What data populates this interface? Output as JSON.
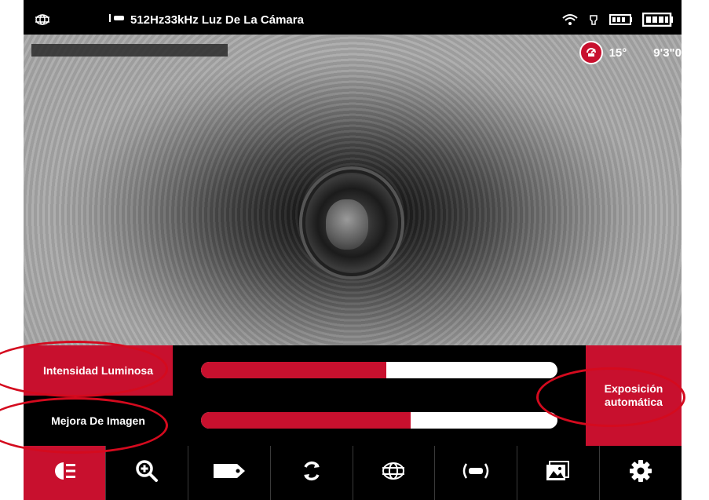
{
  "status_bar": {
    "frequency_text": "512Hz33kHz Luz De La Cámara",
    "icons": [
      "grid-icon",
      "sonde-icon",
      "wifi-icon",
      "flashlight-icon",
      "battery-small-icon",
      "battery-large-icon"
    ]
  },
  "camera": {
    "tilt": "15°",
    "distance": "9'3\"0"
  },
  "controls": {
    "intensidad_label": "Intensidad Luminosa",
    "mejora_label": "Mejora De Imagen",
    "exposicion_label": "Exposición automática",
    "intensidad_level": 0.53,
    "mejora_level": 0.6
  },
  "toolbar": {
    "buttons": [
      {
        "name": "light-button",
        "icon": "light-icon",
        "active": true
      },
      {
        "name": "zoom-button",
        "icon": "zoom-in-icon",
        "active": false
      },
      {
        "name": "tag-button",
        "icon": "tag-icon",
        "active": false
      },
      {
        "name": "rotate-button",
        "icon": "rotate-icon",
        "active": false
      },
      {
        "name": "locator-button",
        "icon": "grid-icon",
        "active": false
      },
      {
        "name": "sonde-button",
        "icon": "sonde-icon",
        "active": false
      },
      {
        "name": "gallery-button",
        "icon": "gallery-icon",
        "active": false
      },
      {
        "name": "settings-button",
        "icon": "gear-icon",
        "active": false
      }
    ]
  },
  "colors": {
    "accent": "#c8102e",
    "annotation": "#d40a1e"
  }
}
